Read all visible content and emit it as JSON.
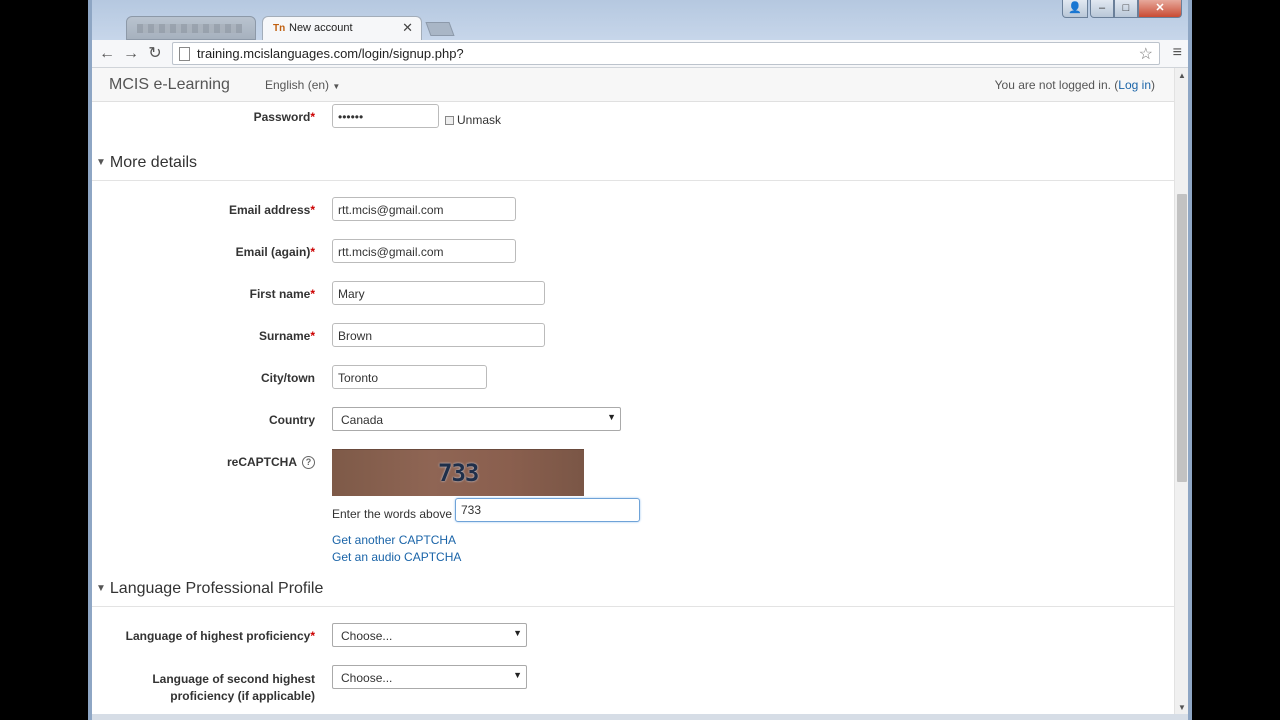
{
  "browser": {
    "inactive_tab_title": "",
    "active_tab_title": "New account",
    "active_tab_favicon": "Tn",
    "url": "training.mcislanguages.com/login/signup.php?"
  },
  "navbar": {
    "brand": "MCIS e-Learning",
    "language": "English (en)",
    "login_prefix": "You are not logged in. (",
    "login_link": "Log in",
    "login_suffix": ")"
  },
  "form": {
    "password": {
      "label": "Password",
      "value": "••••••",
      "unmask_label": "Unmask"
    },
    "more_details": {
      "heading": "More details",
      "email": {
        "label": "Email address",
        "value": "rtt.mcis@gmail.com"
      },
      "email_again": {
        "label": "Email (again)",
        "value": "rtt.mcis@gmail.com"
      },
      "first_name": {
        "label": "First name",
        "value": "Mary"
      },
      "surname": {
        "label": "Surname",
        "value": "Brown"
      },
      "city": {
        "label": "City/town",
        "value": "Toronto"
      },
      "country": {
        "label": "Country",
        "value": "Canada"
      },
      "recaptcha": {
        "label": "reCAPTCHA",
        "image_text": "733",
        "prompt": "Enter the words above",
        "value": "733",
        "another_link": "Get another CAPTCHA",
        "audio_link": "Get an audio CAPTCHA"
      }
    },
    "language_profile": {
      "heading": "Language Professional Profile",
      "highest": {
        "label": "Language of highest proficiency",
        "value": "Choose..."
      },
      "second_line1": "Language of second highest",
      "second_line2": "proficiency (if applicable)",
      "second_value": "Choose..."
    }
  },
  "icons": {
    "back": "←",
    "forward": "→",
    "reload": "↻",
    "star": "☆",
    "menu": "≡",
    "close": "✕",
    "help": "?",
    "section_toggle": "▼",
    "dropdown": "▼"
  }
}
